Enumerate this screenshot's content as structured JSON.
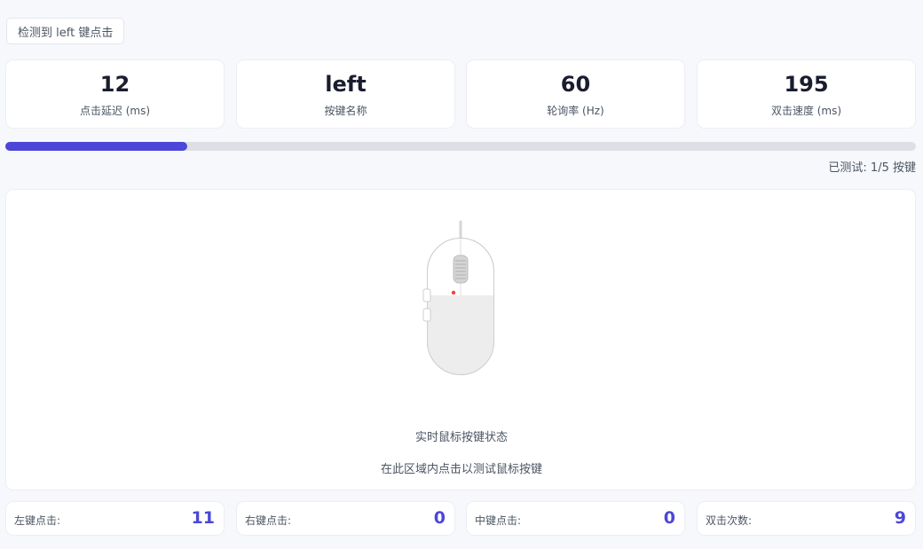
{
  "status": {
    "detected": "检测到 left 键点击"
  },
  "stats": [
    {
      "value": "12",
      "label": "点击延迟 (ms)"
    },
    {
      "value": "left",
      "label": "按键名称"
    },
    {
      "value": "60",
      "label": "轮询率 (Hz)"
    },
    {
      "value": "195",
      "label": "双击速度 (ms)"
    }
  ],
  "progress": {
    "tested": 1,
    "total": 5,
    "fraction": 0.2,
    "text": "已测试: 1/5 按键"
  },
  "test_area": {
    "title": "实时鼠标按键状态",
    "hint": "在此区域内点击以测试鼠标按键"
  },
  "counters": [
    {
      "label": "左键点击:",
      "value": "11"
    },
    {
      "label": "右键点击:",
      "value": "0"
    },
    {
      "label": "中键点击:",
      "value": "0"
    },
    {
      "label": "双击次数:",
      "value": "9"
    }
  ],
  "colors": {
    "accent": "#4c47d8",
    "active_indicator": "#ef4444",
    "background": "#f7f8fc"
  }
}
